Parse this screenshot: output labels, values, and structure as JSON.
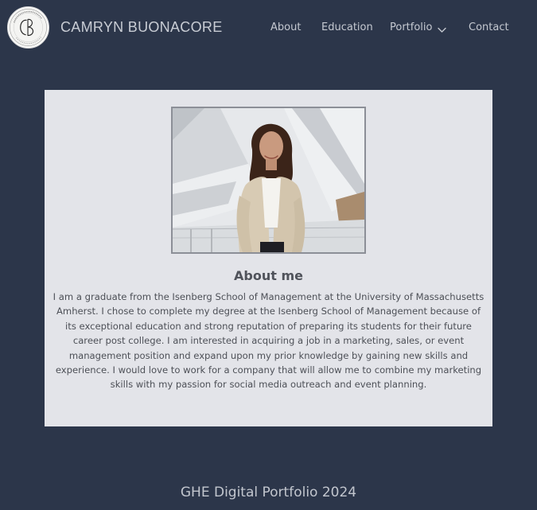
{
  "header": {
    "logo_icon": "cb-monogram-logo",
    "brand_name": "CAMRYN BUONACORE",
    "nav": {
      "about": "About",
      "education": "Education",
      "portfolio": "Portfolio",
      "portfolio_icon": "chevron-down-icon",
      "contact": "Contact"
    }
  },
  "main": {
    "photo_alt": "Portrait photo",
    "about_title": "About me",
    "about_text": "I am a graduate from the Isenberg School of Management at the University of Massachusetts Amherst. I chose to complete my degree at the Isenberg School of Management because of its exceptional education and strong reputation of preparing its students for their future career post college. I am interested in acquiring a job in a marketing, sales, or event management position and expand upon my prior knowledge by gaining new skills and experience. I would love to work for a company that will allow me to combine my marketing skills with my passion for social media outreach and event planning."
  },
  "footer": {
    "text": "GHE Digital Portfolio 2024"
  },
  "colors": {
    "background": "#2c364a",
    "card": "#e3e4e9",
    "nav_text": "#c5c9d1",
    "body_text": "#4d5057"
  }
}
